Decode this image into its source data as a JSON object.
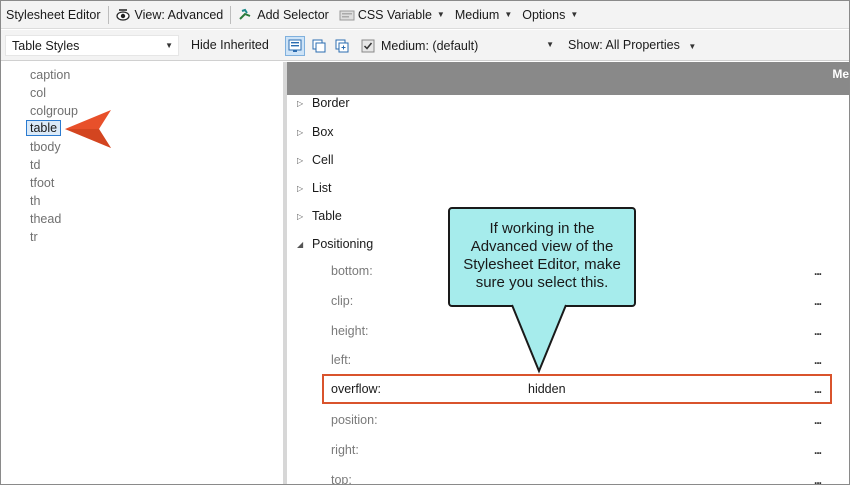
{
  "toolbar_top": {
    "title": "Stylesheet Editor",
    "view_label": "View: Advanced",
    "add_selector": "Add Selector",
    "css_variable": "CSS Variable",
    "medium": "Medium",
    "options": "Options"
  },
  "toolbar_second": {
    "styles_combo": "Table Styles",
    "hide_inherited": "Hide Inherited",
    "medium_combo": "Medium: (default)",
    "show_properties": "Show: All Properties"
  },
  "selectors": [
    "caption",
    "col",
    "colgroup",
    "table",
    "tbody",
    "td",
    "tfoot",
    "th",
    "thead",
    "tr"
  ],
  "selected_selector": "table",
  "header": {
    "label": "Me"
  },
  "categories": [
    {
      "label": "Border",
      "state": "collapsed"
    },
    {
      "label": "Box",
      "state": "collapsed"
    },
    {
      "label": "Cell",
      "state": "collapsed"
    },
    {
      "label": "List",
      "state": "collapsed"
    },
    {
      "label": "Table",
      "state": "collapsed"
    },
    {
      "label": "Positioning",
      "state": "expanded"
    }
  ],
  "properties": [
    {
      "name": "bottom:",
      "value": "",
      "more": "..."
    },
    {
      "name": "clip:",
      "value": "",
      "more": "..."
    },
    {
      "name": "height:",
      "value": "",
      "more": "..."
    },
    {
      "name": "left:",
      "value": "",
      "more": "..."
    },
    {
      "name": "overflow:",
      "value": "hidden",
      "more": "..."
    },
    {
      "name": "position:",
      "value": "",
      "more": "..."
    },
    {
      "name": "right:",
      "value": "",
      "more": "..."
    },
    {
      "name": "top:",
      "value": "",
      "more": "..."
    }
  ],
  "callout": {
    "text": "If working in the Advanced view of the Stylesheet Editor, make sure you select this."
  },
  "colors": {
    "accent_orange": "#e8502a",
    "callout_fill": "#a6ecec",
    "header_gray": "#898989",
    "selection_blue": "#2b7bd0"
  }
}
